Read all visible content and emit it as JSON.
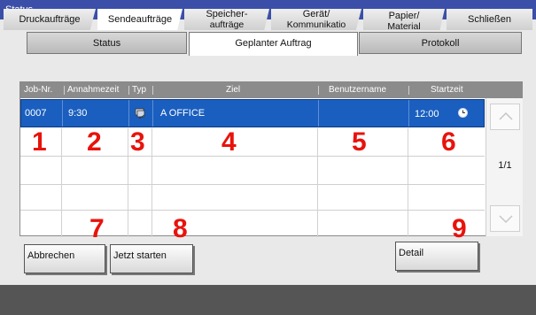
{
  "window": {
    "title": "Status"
  },
  "tabs": [
    {
      "label": "Status"
    },
    {
      "label": "Geplanter Auftrag"
    },
    {
      "label": "Protokoll"
    }
  ],
  "table": {
    "headers": [
      "Job-Nr.",
      "Annahmezeit",
      "Typ",
      "Ziel",
      "Benutzername",
      "Startzeit"
    ],
    "rows": [
      {
        "job": "0007",
        "time": "9:30",
        "type_icon": "send-job-icon",
        "target": "A OFFICE",
        "user": "",
        "start": "12:00",
        "start_icon": "clock-icon"
      }
    ]
  },
  "pagination": {
    "page": "1/1"
  },
  "callouts": [
    "1",
    "2",
    "3",
    "4",
    "5",
    "6",
    "7",
    "8",
    "9"
  ],
  "buttons": {
    "cancel": "Abbrechen",
    "start_now": "Jetzt starten",
    "detail": "Detail"
  },
  "bottom_tabs": [
    {
      "line1": "Druckaufträge",
      "line2": ""
    },
    {
      "line1": "Sendeaufträge",
      "line2": ""
    },
    {
      "line1": "Speicher-",
      "line2": "aufträge"
    },
    {
      "line1": "Gerät/",
      "line2": "Kommunikatio"
    },
    {
      "line1": "Papier/",
      "line2": "Material"
    }
  ],
  "close_label": "Schließen",
  "colors": {
    "title_bar": "#3b4fa8",
    "selection": "#1a5fbf",
    "callout": "#e8130c"
  }
}
